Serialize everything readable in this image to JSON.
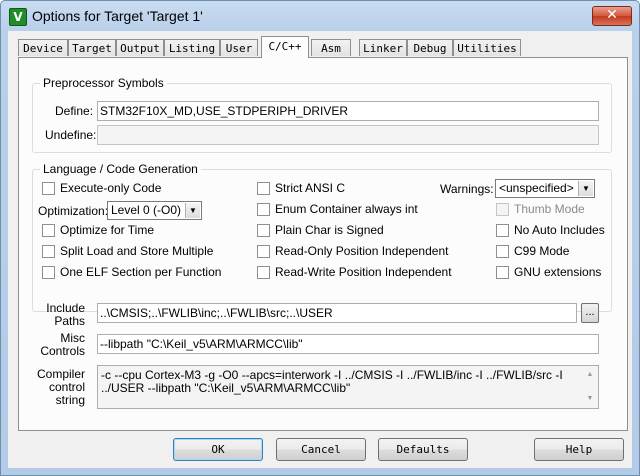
{
  "window": {
    "title": "Options for Target 'Target 1'",
    "icon": "keil-uvision-icon",
    "close_glyph": "✕"
  },
  "tabs": [
    {
      "label": "Device",
      "active": false
    },
    {
      "label": "Target",
      "active": false
    },
    {
      "label": "Output",
      "active": false
    },
    {
      "label": "Listing",
      "active": false
    },
    {
      "label": "User",
      "active": false
    },
    {
      "label": "C/C++",
      "active": true
    },
    {
      "label": "Asm",
      "active": false
    },
    {
      "label": "Linker",
      "active": false
    },
    {
      "label": "Debug",
      "active": false
    },
    {
      "label": "Utilities",
      "active": false
    }
  ],
  "preprocessor": {
    "title": "Preprocessor Symbols",
    "define_label": "Define:",
    "define_value": "STM32F10X_MD,USE_STDPERIPH_DRIVER",
    "undefine_label": "Undefine:",
    "undefine_value": ""
  },
  "language": {
    "title": "Language / Code Generation",
    "execute_only": {
      "label": "Execute-only Code",
      "checked": false
    },
    "optimization_label": "Optimization:",
    "optimization_value": "Level 0 (-O0)",
    "optimize_time": {
      "label": "Optimize for Time",
      "checked": false
    },
    "split_load": {
      "label": "Split Load and Store Multiple",
      "checked": false
    },
    "one_elf": {
      "label": "One ELF Section per Function",
      "checked": false
    },
    "strict_ansi": {
      "label": "Strict ANSI C",
      "checked": false
    },
    "enum_container": {
      "label": "Enum Container always int",
      "checked": false
    },
    "plain_char": {
      "label": "Plain Char is Signed",
      "checked": false
    },
    "ro_pi": {
      "label": "Read-Only Position Independent",
      "checked": false
    },
    "rw_pi": {
      "label": "Read-Write Position Independent",
      "checked": false
    },
    "warnings_label": "Warnings:",
    "warnings_value": "<unspecified>",
    "thumb_mode": {
      "label": "Thumb Mode",
      "checked": false,
      "disabled": true
    },
    "no_auto_includes": {
      "label": "No Auto Includes",
      "checked": false
    },
    "c99_mode": {
      "label": "C99 Mode",
      "checked": false
    },
    "gnu_extensions": {
      "label": "GNU extensions",
      "checked": false
    }
  },
  "include_paths": {
    "label_line1": "Include",
    "label_line2": "Paths",
    "value": "..\\CMSIS;..\\FWLIB\\inc;..\\FWLIB\\src;..\\USER",
    "browse_label": "..."
  },
  "misc_controls": {
    "label_line1": "Misc",
    "label_line2": "Controls",
    "value": "--libpath \"C:\\Keil_v5\\ARM\\ARMCC\\lib\""
  },
  "compiler_string": {
    "label_line1": "Compiler",
    "label_line2": "control",
    "label_line3": "string",
    "value": "-c --cpu Cortex-M3 -g -O0 --apcs=interwork -I ../CMSIS -I ../FWLIB/inc -I ../FWLIB/src -I ../USER --libpath \"C:\\Keil_v5\\ARM\\ARMCC\\lib\""
  },
  "buttons": {
    "ok": "OK",
    "cancel": "Cancel",
    "defaults": "Defaults",
    "help": "Help"
  }
}
